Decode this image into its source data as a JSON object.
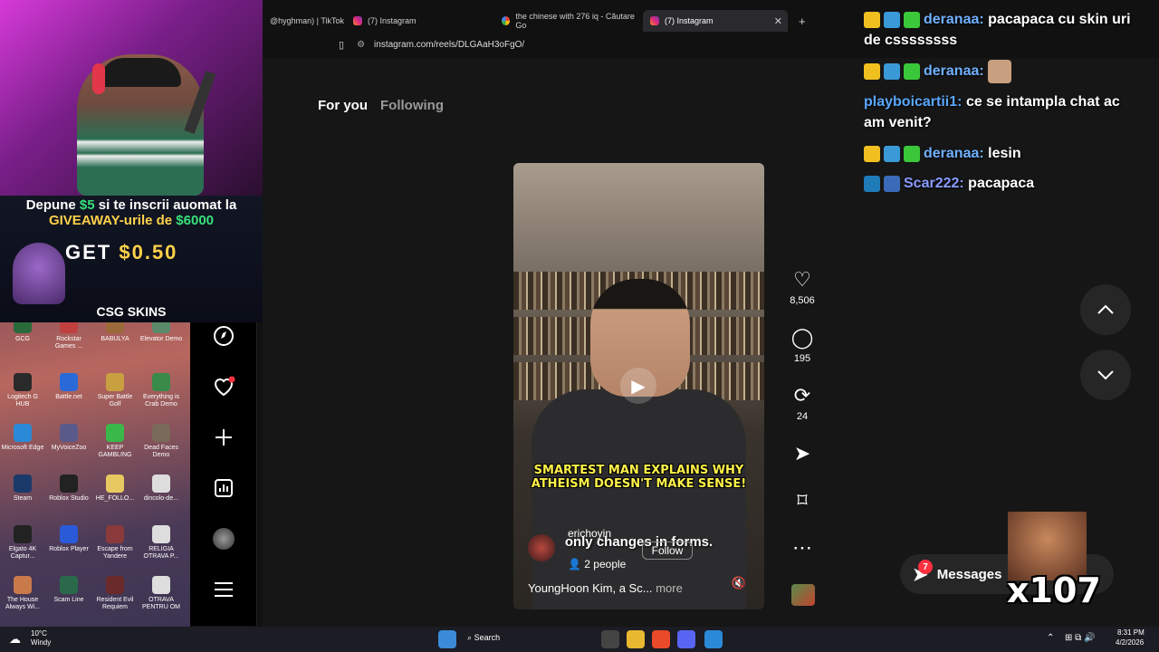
{
  "browser": {
    "tabs": [
      {
        "label": "@hyghman) | TikTok"
      },
      {
        "label": "(7) Instagram"
      },
      {
        "label": "the chinese with 276 iq - Căutare Go"
      },
      {
        "label": "(7) Instagram"
      }
    ],
    "url": "instagram.com/reels/DLGAaH3oFgO/"
  },
  "promo": {
    "line1_pre": "Depune ",
    "line1_amount": "$5",
    "line1_post": " si te inscrii auomat la",
    "line2_pre": "GIVEAWAY-urile de ",
    "line2_amount": "$6000",
    "get": "GET",
    "get_amount": "$0.50",
    "brand": "CSG SKINS"
  },
  "feed": {
    "tab_foryou": "For you",
    "tab_following": "Following"
  },
  "reel": {
    "caption_line1": "SMARTEST MAN EXPLAINS WHY",
    "caption_line2": "ATHEISM DOESN'T MAKE SENSE!",
    "subtitle": "only changes in forms.",
    "username": "erichoyin",
    "follow": "Follow",
    "people": "2 people",
    "description": "YoungHoon Kim, a Sc...",
    "more": "more"
  },
  "actions": {
    "likes": "8,506",
    "comments": "195",
    "reposts": "24"
  },
  "messages": {
    "label": "Messages",
    "badge": "7"
  },
  "chat": {
    "m1_name": "deranaa:",
    "m1_text": "pacapaca cu skin uri de cssssssss",
    "m2_name": "deranaa:",
    "m3_name": "playboicartii1:",
    "m3_text": "ce se intampla chat ac am venit?",
    "m4_name": "deranaa:",
    "m4_text": "lesin",
    "m5_name": "Scar222:",
    "m5_text": "pacapaca"
  },
  "overlay": {
    "counter": "x107"
  },
  "desktop": {
    "icons": [
      "GCG",
      "Rockstar Games ...",
      "BABULYA",
      "Elevator Demo",
      "Logitech G HUB",
      "Battle.net",
      "Super Battle Golf",
      "Everything is Crab Demo",
      "Microsoft Edge",
      "MyVoiceZoo",
      "KEEP GAMBLING",
      "Dead Faces Demo",
      "Steam",
      "Roblox Studio",
      "HE_FOLLO...",
      "dincolo-de...",
      "Elgato 4K Captur...",
      "Roblox Player",
      "Escape from Yandere",
      "RELIGIA OTRAVA P...",
      "The House Always Wi...",
      "Scam Line",
      "Resident Evil Requiem",
      "OTRAVA PENTRU OM"
    ]
  },
  "taskbar": {
    "weather_temp": "10°C",
    "weather_desc": "Windy",
    "search": "Search",
    "time": "8:31 PM",
    "date": "4/2/2026"
  }
}
